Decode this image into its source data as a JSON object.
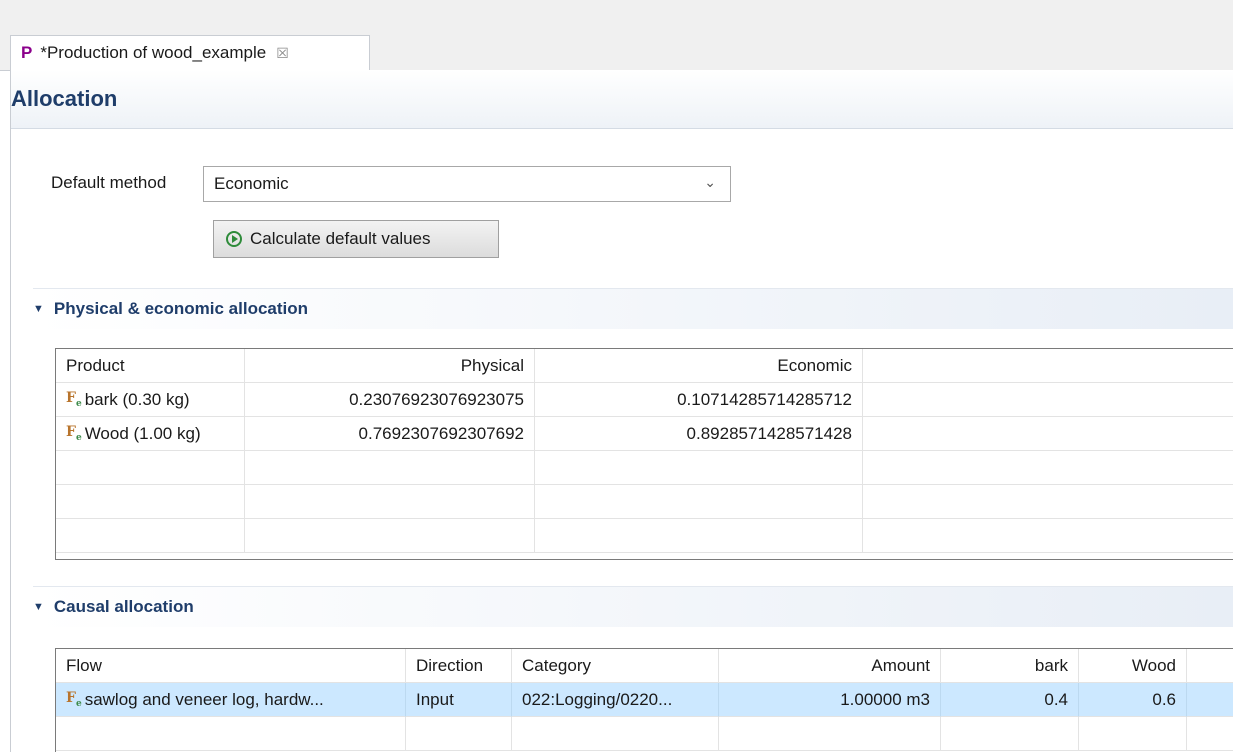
{
  "editor_tab": {
    "prefix": "P",
    "title": "*Production of wood_example",
    "close": "☒"
  },
  "form": {
    "title": "Allocation"
  },
  "default_method": {
    "label": "Default method",
    "value": "Economic"
  },
  "calculate_button": {
    "label": "Calculate default values"
  },
  "physical_section": {
    "title": "Physical & economic allocation",
    "headers": [
      "Product",
      "Physical",
      "Economic"
    ],
    "rows": [
      {
        "product": "bark (0.30 kg)",
        "physical": "0.23076923076923075",
        "economic": "0.10714285714285712"
      },
      {
        "product": "Wood (1.00 kg)",
        "physical": "0.7692307692307692",
        "economic": "0.8928571428571428"
      }
    ]
  },
  "causal_section": {
    "title": "Causal allocation",
    "headers": [
      "Flow",
      "Direction",
      "Category",
      "Amount",
      "bark",
      "Wood"
    ],
    "rows": [
      {
        "flow": "sawlog and veneer log, hardw...",
        "direction": "Input",
        "category": "022:Logging/0220...",
        "amount": "1.00000 m3",
        "bark": "0.4",
        "wood": "0.6"
      }
    ]
  },
  "icons": {
    "flow": "product-flow-icon",
    "run": "run-icon",
    "dropdown": "chevron-down-icon",
    "twistie": "twistie-expanded-icon"
  },
  "colors": {
    "header_text": "#1f3d6a",
    "selection": "#cce8ff",
    "tab_marker": "#8b008b"
  }
}
